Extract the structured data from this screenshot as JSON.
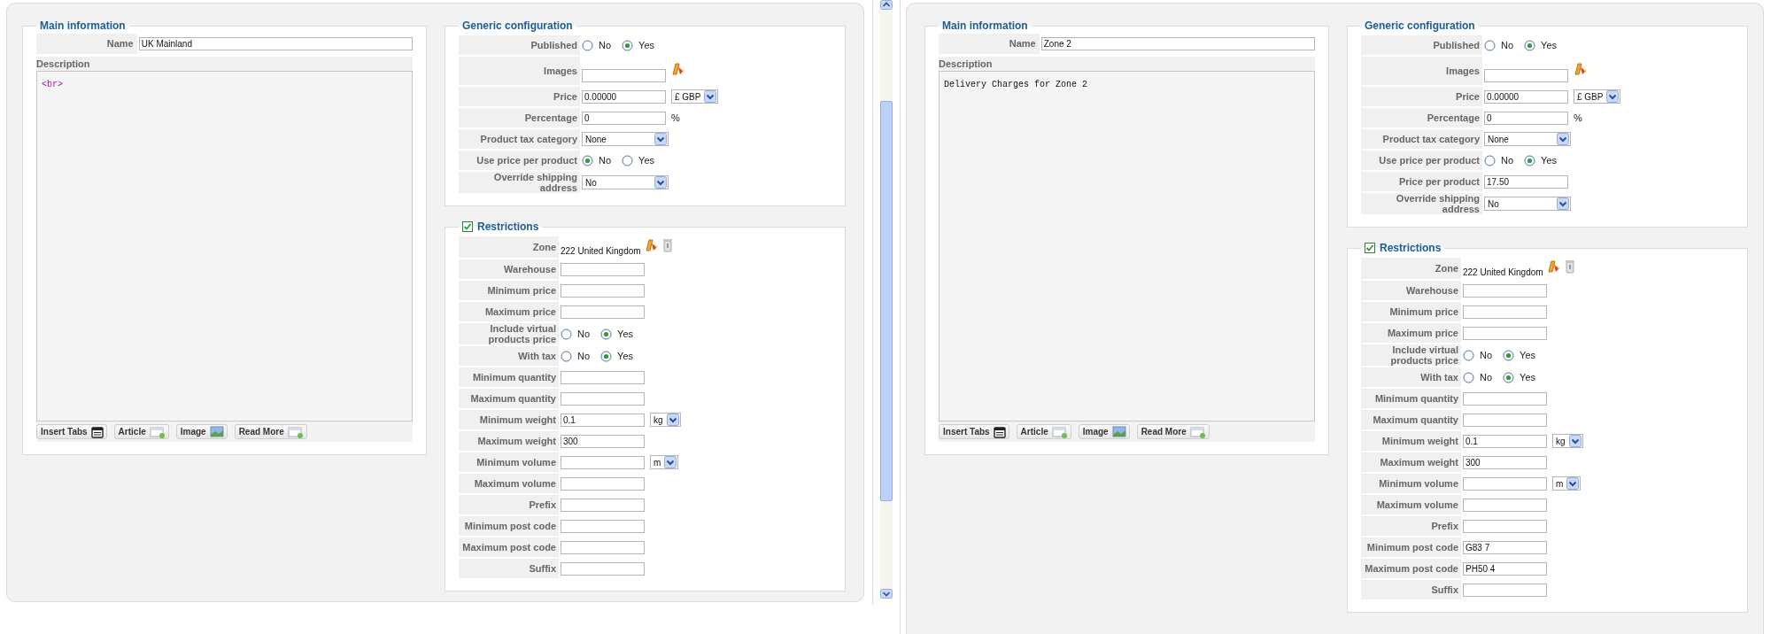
{
  "screens": [
    {
      "main_information": {
        "title": "Main information",
        "name_label": "Name",
        "name_value": "UK Mainland",
        "description_label": "Description",
        "description": {
          "kind": "markup",
          "text": "<br>"
        },
        "editor_buttons": [
          {
            "label": "Insert Tabs",
            "kind": "tabs"
          },
          {
            "label": "Article",
            "kind": "article"
          },
          {
            "label": "Image",
            "kind": "image"
          },
          {
            "label": "Read More",
            "kind": "readmore"
          }
        ]
      },
      "generic_configuration": {
        "title": "Generic configuration",
        "rows": [
          {
            "label": "Published",
            "kind": "radio",
            "options": [
              {
                "label": "No",
                "selected": false
              },
              {
                "label": "Yes",
                "selected": true
              }
            ]
          },
          {
            "label": "Images",
            "kind": "image"
          },
          {
            "label": "Price",
            "kind": "field",
            "value": "0.00000",
            "addon": {
              "kind": "select",
              "value": "£ GBP"
            }
          },
          {
            "label": "Percentage",
            "kind": "field",
            "value": "0",
            "addon": {
              "kind": "text",
              "value": "%"
            }
          },
          {
            "label": "Product tax category",
            "kind": "select",
            "value": "None"
          },
          {
            "label": "Use price per product",
            "kind": "radio",
            "options": [
              {
                "label": "No",
                "selected": true
              },
              {
                "label": "Yes",
                "selected": false
              }
            ]
          },
          {
            "label": "Override shipping address",
            "kind": "select",
            "value": "No"
          }
        ]
      },
      "restrictions": {
        "title": "Restrictions",
        "checked": true,
        "rows": [
          {
            "label": "Zone",
            "kind": "zone",
            "value": "222 United Kingdom"
          },
          {
            "label": "Warehouse",
            "kind": "field"
          },
          {
            "label": "Minimum price",
            "kind": "field"
          },
          {
            "label": "Maximum price",
            "kind": "field"
          },
          {
            "label": "Include virtual products price",
            "kind": "radio",
            "options": [
              {
                "label": "No",
                "selected": false
              },
              {
                "label": "Yes",
                "selected": true
              }
            ]
          },
          {
            "label": "With tax",
            "kind": "radio",
            "options": [
              {
                "label": "No",
                "selected": false
              },
              {
                "label": "Yes",
                "selected": true
              }
            ]
          },
          {
            "label": "Minimum quantity",
            "kind": "field"
          },
          {
            "label": "Maximum quantity",
            "kind": "field"
          },
          {
            "label": "Minimum weight",
            "kind": "field",
            "value": "0.1",
            "addon": {
              "kind": "select",
              "value": "kg"
            }
          },
          {
            "label": "Maximum weight",
            "kind": "field",
            "value": "300"
          },
          {
            "label": "Minimum volume",
            "kind": "field",
            "addon": {
              "kind": "select",
              "value": "m"
            }
          },
          {
            "label": "Maximum volume",
            "kind": "field"
          },
          {
            "label": "Prefix",
            "kind": "field"
          },
          {
            "label": "Minimum post code",
            "kind": "field"
          },
          {
            "label": "Maximum post code",
            "kind": "field"
          },
          {
            "label": "Suffix",
            "kind": "field"
          }
        ]
      }
    },
    {
      "main_information": {
        "title": "Main information",
        "name_label": "Name",
        "name_value": "Zone 2",
        "description_label": "Description",
        "description": {
          "kind": "text",
          "text": "Delivery Charges for Zone 2"
        },
        "editor_buttons": [
          {
            "label": "Insert Tabs",
            "kind": "tabs"
          },
          {
            "label": "Article",
            "kind": "article"
          },
          {
            "label": "Image",
            "kind": "image"
          },
          {
            "label": "Read More",
            "kind": "readmore"
          }
        ]
      },
      "generic_configuration": {
        "title": "Generic configuration",
        "rows": [
          {
            "label": "Published",
            "kind": "radio",
            "options": [
              {
                "label": "No",
                "selected": false
              },
              {
                "label": "Yes",
                "selected": true
              }
            ]
          },
          {
            "label": "Images",
            "kind": "image"
          },
          {
            "label": "Price",
            "kind": "field",
            "value": "0.00000",
            "addon": {
              "kind": "select",
              "value": "£ GBP"
            }
          },
          {
            "label": "Percentage",
            "kind": "field",
            "value": "0",
            "addon": {
              "kind": "text",
              "value": "%"
            }
          },
          {
            "label": "Product tax category",
            "kind": "select",
            "value": "None"
          },
          {
            "label": "Use price per product",
            "kind": "radio",
            "options": [
              {
                "label": "No",
                "selected": false
              },
              {
                "label": "Yes",
                "selected": true
              }
            ]
          },
          {
            "label": "Price per product",
            "kind": "field",
            "value": "17.50"
          },
          {
            "label": "Override shipping address",
            "kind": "select",
            "value": "No"
          }
        ]
      },
      "restrictions": {
        "title": "Restrictions",
        "checked": true,
        "rows": [
          {
            "label": "Zone",
            "kind": "zone",
            "value": "222 United Kingdom"
          },
          {
            "label": "Warehouse",
            "kind": "field"
          },
          {
            "label": "Minimum price",
            "kind": "field"
          },
          {
            "label": "Maximum price",
            "kind": "field"
          },
          {
            "label": "Include virtual products price",
            "kind": "radio",
            "options": [
              {
                "label": "No",
                "selected": false
              },
              {
                "label": "Yes",
                "selected": true
              }
            ]
          },
          {
            "label": "With tax",
            "kind": "radio",
            "options": [
              {
                "label": "No",
                "selected": false
              },
              {
                "label": "Yes",
                "selected": true
              }
            ]
          },
          {
            "label": "Minimum quantity",
            "kind": "field"
          },
          {
            "label": "Maximum quantity",
            "kind": "field"
          },
          {
            "label": "Minimum weight",
            "kind": "field",
            "value": "0.1",
            "addon": {
              "kind": "select",
              "value": "kg"
            }
          },
          {
            "label": "Maximum weight",
            "kind": "field",
            "value": "300"
          },
          {
            "label": "Minimum volume",
            "kind": "field",
            "addon": {
              "kind": "select",
              "value": "m"
            }
          },
          {
            "label": "Maximum volume",
            "kind": "field"
          },
          {
            "label": "Prefix",
            "kind": "field"
          },
          {
            "label": "Minimum post code",
            "kind": "field",
            "value": "G83 7"
          },
          {
            "label": "Maximum post code",
            "kind": "field",
            "value": "PH50 4"
          },
          {
            "label": "Suffix",
            "kind": "field"
          }
        ]
      }
    }
  ]
}
